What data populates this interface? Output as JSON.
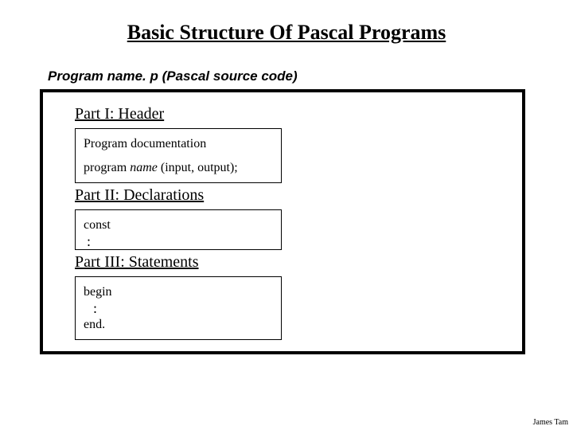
{
  "title": "Basic Structure Of Pascal Programs",
  "source_line": "Program name. p (Pascal source code)",
  "part1": {
    "heading": "Part I: Header",
    "doc": "Program documentation",
    "syntax_pre": "program ",
    "syntax_name": "name",
    "syntax_post": " (input, output);"
  },
  "part2": {
    "heading": "Part II: Declarations",
    "kw": "const",
    "vdots": ":"
  },
  "part3": {
    "heading": "Part III: Statements",
    "begin": "begin",
    "vdots": ":",
    "end": "end."
  },
  "footer": "James Tam"
}
